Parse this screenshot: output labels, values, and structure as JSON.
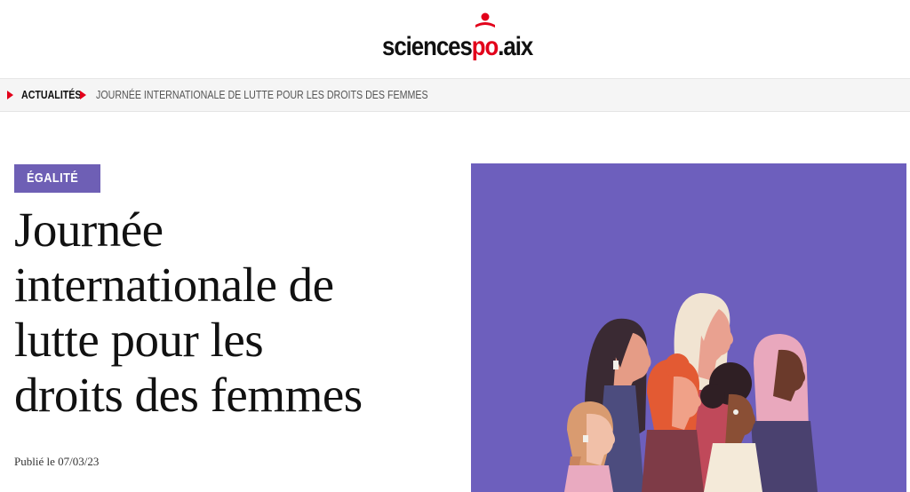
{
  "brand": {
    "logo_main": "sciences",
    "logo_accent": "po",
    "logo_suffix": ".aix",
    "accent_color": "#e2001a"
  },
  "breadcrumb": {
    "home": "ACTUALITÉS",
    "current": "JOURNÉE INTERNATIONALE DE LUTTE POUR LES DROITS DES FEMMES"
  },
  "article": {
    "category": "ÉGALITÉ",
    "title_lines": [
      "Journée",
      "internationale de",
      "lutte pour les",
      "droits des femmes"
    ],
    "published": "Publié le 07/03/23",
    "tag_color": "#6e5fb5"
  },
  "hero": {
    "background_color": "#6d5fbd"
  }
}
